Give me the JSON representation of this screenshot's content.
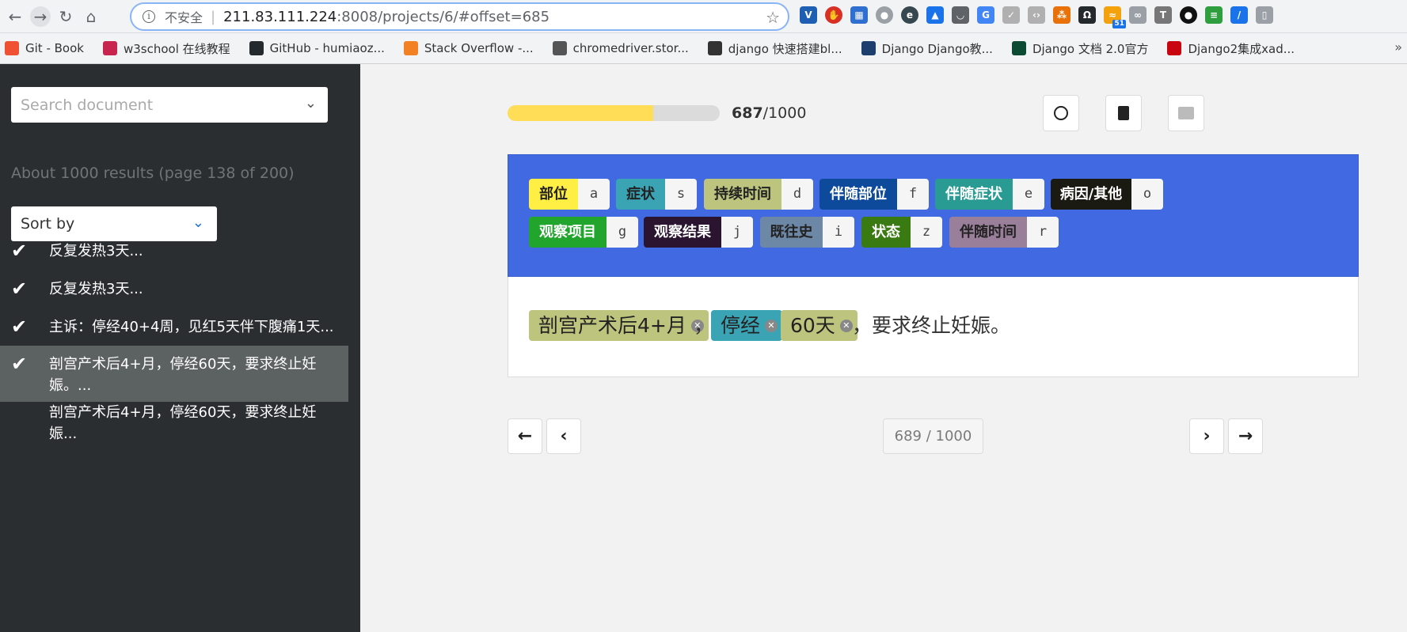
{
  "browser": {
    "url_insecure_label": "不安全",
    "url_host": "211.83.111.224",
    "url_path": ":8008/projects/6/#offset=685",
    "bookmarks": [
      {
        "label": "Git - Book",
        "icon": "git-icon",
        "color": "#f05133"
      },
      {
        "label": "w3school 在线教程",
        "icon": "w3school-icon",
        "color": "#c7254e"
      },
      {
        "label": "GitHub - humiaoz...",
        "icon": "github-icon",
        "color": "#24292e"
      },
      {
        "label": "Stack Overflow -...",
        "icon": "stackoverflow-icon",
        "color": "#f48024"
      },
      {
        "label": "chromedriver.stor...",
        "icon": "globe-icon",
        "color": "#555555"
      },
      {
        "label": "django 快速搭建bl...",
        "icon": "django-blog-icon",
        "color": "#333333"
      },
      {
        "label": "Django Django教...",
        "icon": "lj-icon",
        "color": "#1c3f6e"
      },
      {
        "label": "Django 文档 2.0官方",
        "icon": "django-icon",
        "color": "#0c4b33"
      },
      {
        "label": "Django2集成xad...",
        "icon": "csdn-icon",
        "color": "#c9060f"
      }
    ],
    "extension_badge": "51"
  },
  "sidebar": {
    "search_placeholder": "Search document",
    "results_info": "About 1000 results (page 138 of 200)",
    "sort_label": "Sort by",
    "documents": [
      {
        "text": "反复发热3天...",
        "checked": true,
        "active": false
      },
      {
        "text": "反复发热3天...",
        "checked": true,
        "active": false
      },
      {
        "text": "主诉：停经40+4周，见红5天伴下腹痛1天...",
        "checked": true,
        "active": false
      },
      {
        "text": "剖宫产术后4+月，停经60天，要求终止妊娠。...",
        "checked": true,
        "active": true
      },
      {
        "text": "剖宫产术后4+月，停经60天，要求终止妊娠...",
        "checked": false,
        "active": false
      }
    ]
  },
  "progress": {
    "done": "687",
    "total": "/1000",
    "fraction": 0.687
  },
  "labels": [
    {
      "name": "部位",
      "key": "a",
      "color": "#ffee44",
      "text_color": "#222"
    },
    {
      "name": "症状",
      "key": "s",
      "color": "#3aa3b4",
      "text_color": "#222"
    },
    {
      "name": "持续时间",
      "key": "d",
      "color": "#bcc47e",
      "text_color": "#222"
    },
    {
      "name": "伴随部位",
      "key": "f",
      "color": "#0d4a9c",
      "text_color": "#fff"
    },
    {
      "name": "伴随症状",
      "key": "e",
      "color": "#2a9b93",
      "text_color": "#fff"
    },
    {
      "name": "病因/其他",
      "key": "o",
      "color": "#1a1a12",
      "text_color": "#fff"
    },
    {
      "name": "观察项目",
      "key": "g",
      "color": "#22a52c",
      "text_color": "#fff"
    },
    {
      "name": "观察结果",
      "key": "j",
      "color": "#2b1430",
      "text_color": "#fff"
    },
    {
      "name": "既往史",
      "key": "i",
      "color": "#6d87a6",
      "text_color": "#222"
    },
    {
      "name": "状态",
      "key": "z",
      "color": "#3a7a12",
      "text_color": "#fff"
    },
    {
      "name": "伴随时间",
      "key": "r",
      "color": "#9a7f9a",
      "text_color": "#222"
    }
  ],
  "annotation": {
    "span1": "剖宫产术后4+月",
    "comma1": "，",
    "span2": "停经",
    "span3": "60天",
    "rest": "，要求终止妊娠。",
    "span1_color": "#bcc47e",
    "span2_color": "#3aa3b4",
    "span3_color": "#bcc47e"
  },
  "pagination": {
    "indicator": "689 / 1000"
  }
}
